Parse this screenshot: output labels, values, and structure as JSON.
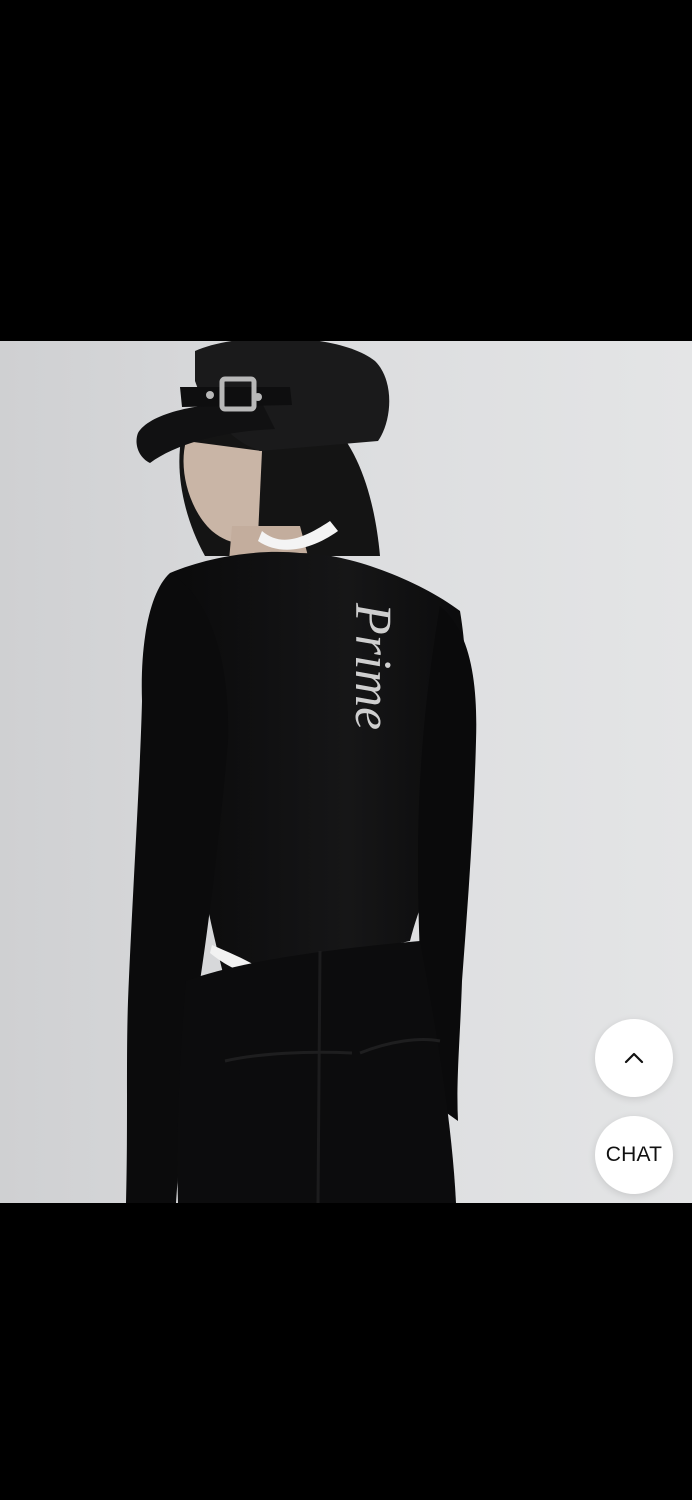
{
  "product_image": {
    "print_text": "Prime",
    "colors": {
      "background": "#d9dadb",
      "garment": "#0c0c0d",
      "print": "#cfcfcf"
    }
  },
  "floating_buttons": {
    "scroll_top_icon": "chevron-up-icon",
    "chat_label": "CHAT"
  },
  "colors": {
    "letterbox": "#000000",
    "fab_background": "#ffffff",
    "fab_text": "#111111"
  }
}
